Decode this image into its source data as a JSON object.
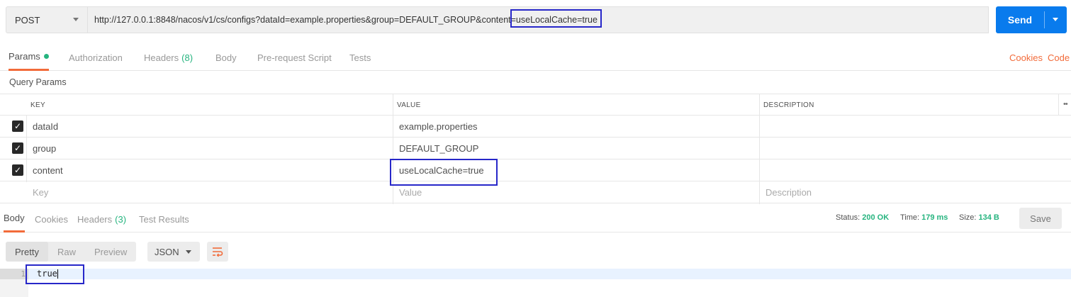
{
  "request": {
    "method": "POST",
    "url": "http://127.0.0.1:8848/nacos/v1/cs/configs?dataId=example.properties&group=DEFAULT_GROUP&content=useLocalCache=true",
    "send_label": "Send"
  },
  "req_tabs": {
    "params": "Params",
    "authorization": "Authorization",
    "headers": "Headers",
    "headers_count": "(8)",
    "body": "Body",
    "prerequest": "Pre-request Script",
    "tests": "Tests",
    "cookies": "Cookies",
    "code": "Code"
  },
  "query_params": {
    "title": "Query Params",
    "columns": [
      "KEY",
      "VALUE",
      "DESCRIPTION"
    ],
    "rows": [
      {
        "key": "dataId",
        "value": "example.properties",
        "checked": true
      },
      {
        "key": "group",
        "value": "DEFAULT_GROUP",
        "checked": true
      },
      {
        "key": "content",
        "value": "useLocalCache=true",
        "checked": true
      }
    ],
    "placeholders": {
      "key": "Key",
      "value": "Value",
      "description": "Description"
    }
  },
  "response": {
    "tabs": {
      "body": "Body",
      "cookies": "Cookies",
      "headers": "Headers",
      "headers_count": "(3)",
      "test_results": "Test Results"
    },
    "status_label": "Status:",
    "status_value": "200 OK",
    "time_label": "Time:",
    "time_value": "179 ms",
    "size_label": "Size:",
    "size_value": "134 B",
    "save_label": "Save",
    "format_buttons": [
      "Pretty",
      "Raw",
      "Preview"
    ],
    "format_select": "JSON",
    "line_number": "1",
    "body_text": "true"
  },
  "colors": {
    "accent": "#f26b3a",
    "send_blue": "#097bed",
    "success_green": "#26b47f",
    "highlight_box": "#2727c9"
  }
}
